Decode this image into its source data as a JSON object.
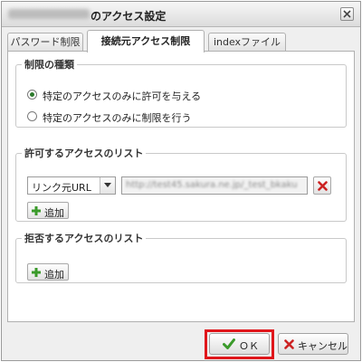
{
  "window": {
    "title_suffix": "のアクセス設定",
    "close_icon": "close-icon"
  },
  "tabs": [
    {
      "label": "パスワード制限",
      "active": false
    },
    {
      "label": "接続元アクセス制限",
      "active": true
    },
    {
      "label": "indexファイル",
      "active": false
    }
  ],
  "restriction_type": {
    "legend": "制限の種類",
    "options": [
      {
        "label": "特定のアクセスのみに許可を与える",
        "selected": true
      },
      {
        "label": "特定のアクセスのみに制限を行う",
        "selected": false
      }
    ]
  },
  "allow_list": {
    "legend": "許可するアクセスのリスト",
    "select_value": "リンク元URL",
    "url_value": "http://test45.sakura.ne.jp/_test_bkaku",
    "add_label": "追加"
  },
  "deny_list": {
    "legend": "拒否するアクセスのリスト",
    "add_label": "追加"
  },
  "footer": {
    "ok_label": "ＯＫ",
    "cancel_label": "キャンセル"
  },
  "colors": {
    "ok_highlight": "#e0161b",
    "check_green": "#3a9a2a",
    "delete_red": "#cc2222"
  }
}
